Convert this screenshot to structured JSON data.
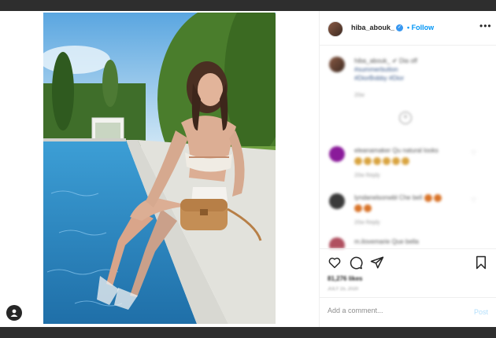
{
  "header": {
    "username": "hiba_abouk_",
    "verified_mark": "✓",
    "separator": "•",
    "follow_label": "Follow",
    "more_label": "•••"
  },
  "comments": [
    {
      "text": "hiba_abouk_ ✔ Dia off",
      "text2": "#summerbutton",
      "text3": "#DiorBobby #Dior",
      "meta": "20w"
    },
    {
      "text": "eleanamaker Qu natural looks",
      "meta": "20w   Reply",
      "emojis": 6
    },
    {
      "text": "lyndanelsonwbl Che bell",
      "meta": "20w   Reply",
      "emojis": 2
    },
    {
      "text": "m.ilovemarie Que bella",
      "meta": ""
    }
  ],
  "load_more": "+",
  "actions": {
    "likes": "81,276 likes",
    "date": "JULY 15, 2020"
  },
  "add_comment": {
    "placeholder": "Add a comment...",
    "post_label": "Post"
  },
  "icons": [
    "heart-icon",
    "comment-icon",
    "share-icon",
    "bookmark-icon",
    "user-icon",
    "more-icon"
  ],
  "colors": {
    "accent": "#0095f6",
    "post_disabled": "#b2dffc",
    "backdrop": "#3a3a3a"
  }
}
